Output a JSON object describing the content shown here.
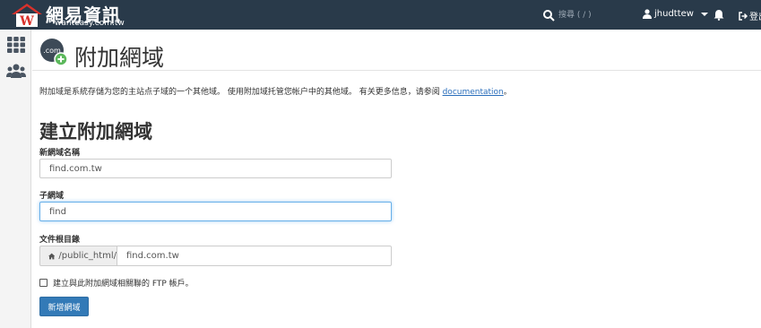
{
  "brand": {
    "title": "網易資訊",
    "subtitle": "wanteasy.com.tw"
  },
  "topbar": {
    "search_placeholder": "搜尋 ( / )",
    "username": "jhudttew",
    "logout_label": "登出"
  },
  "sidebar": {
    "items": [
      {
        "icon": "grid-icon"
      },
      {
        "icon": "users-icon"
      }
    ]
  },
  "page": {
    "icon_text": ".com",
    "title": "附加網域",
    "description": "附加域是系統存儲为您的主站点子域的一个其他域。 使用附加域托管您帐户中的其他域。 有关更多信息，请参阅 ",
    "doc_link": "documentation",
    "description_end": "。"
  },
  "form": {
    "section_title": "建立附加網域",
    "domain_label": "新網域名稱",
    "domain_value": "find.com.tw",
    "subdomain_label": "子網域",
    "subdomain_value": "find",
    "docroot_label": "文件根目錄",
    "docroot_prefix": "/public_html/",
    "docroot_value": "find.com.tw",
    "ftp_label": "建立與此附加網域相關聯的 FTP 帳戶。",
    "submit_label": "新增網域"
  },
  "colors": {
    "topbar": "#293a4a",
    "primary": "#337ab7",
    "link": "#2a6ebb",
    "logo_red": "#d9312b",
    "badge_green": "#5cb85c"
  }
}
